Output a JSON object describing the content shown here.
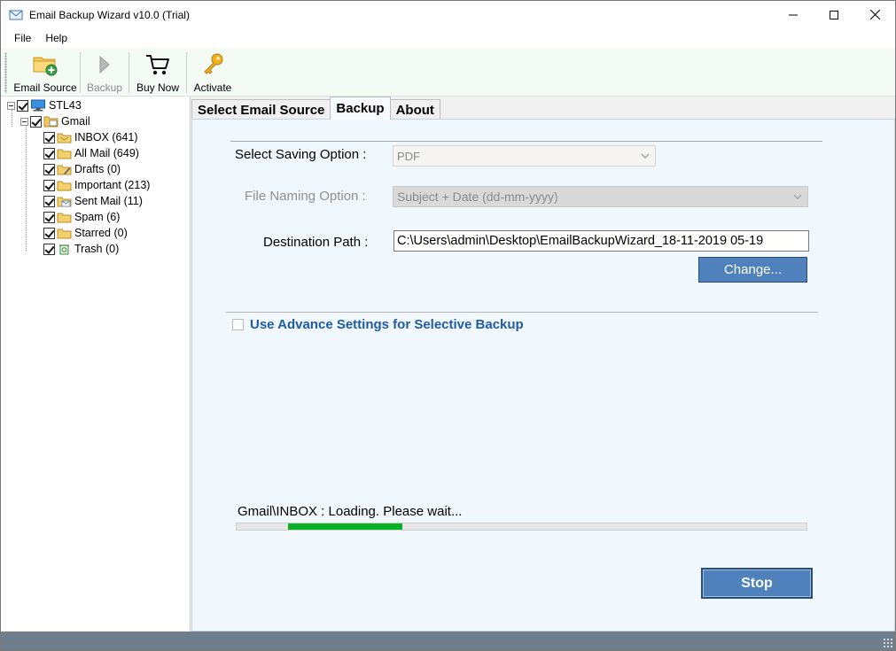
{
  "window": {
    "title": "Email Backup Wizard v10.0 (Trial)",
    "controls": [
      "minimize-icon",
      "maximize-icon",
      "close-icon"
    ]
  },
  "menu": {
    "file": "File",
    "help": "Help"
  },
  "toolbar": {
    "email_source": "Email Source",
    "backup": "Backup",
    "buy_now": "Buy Now",
    "activate": "Activate"
  },
  "tree": {
    "root": "STL43",
    "account": "Gmail",
    "folders": [
      {
        "label": "INBOX (641)",
        "icon": "inbox-folder-icon"
      },
      {
        "label": "All Mail (649)",
        "icon": "folder-icon"
      },
      {
        "label": "Drafts (0)",
        "icon": "drafts-folder-icon"
      },
      {
        "label": "Important (213)",
        "icon": "folder-icon"
      },
      {
        "label": "Sent Mail (11)",
        "icon": "sent-folder-icon"
      },
      {
        "label": "Spam (6)",
        "icon": "folder-icon"
      },
      {
        "label": "Starred (0)",
        "icon": "folder-icon"
      },
      {
        "label": "Trash (0)",
        "icon": "trash-folder-icon"
      }
    ]
  },
  "tabs": {
    "select_source": "Select Email Source",
    "backup": "Backup",
    "about": "About"
  },
  "backup": {
    "saving_option_label": "Select Saving Option :",
    "saving_option_value": "PDF",
    "naming_option_label": "File Naming Option :",
    "naming_option_value": "Subject + Date (dd-mm-yyyy)",
    "destination_label": "Destination Path :",
    "destination_value": "C:\\Users\\admin\\Desktop\\EmailBackupWizard_18-11-2019 05-19",
    "change_button": "Change...",
    "advance_settings": "Use Advance Settings for Selective Backup",
    "status_text": "Gmail\\INBOX : Loading. Please wait...",
    "progress_fraction": 0.2,
    "stop_button": "Stop"
  },
  "colors": {
    "toolbar_bg": "#f3fbf4",
    "panel_bg": "#f0f7fd",
    "button_blue": "#4f81bd",
    "progress_green": "#06b025",
    "link_blue": "#1f5aa6",
    "statusbar": "#6f7e8c"
  }
}
